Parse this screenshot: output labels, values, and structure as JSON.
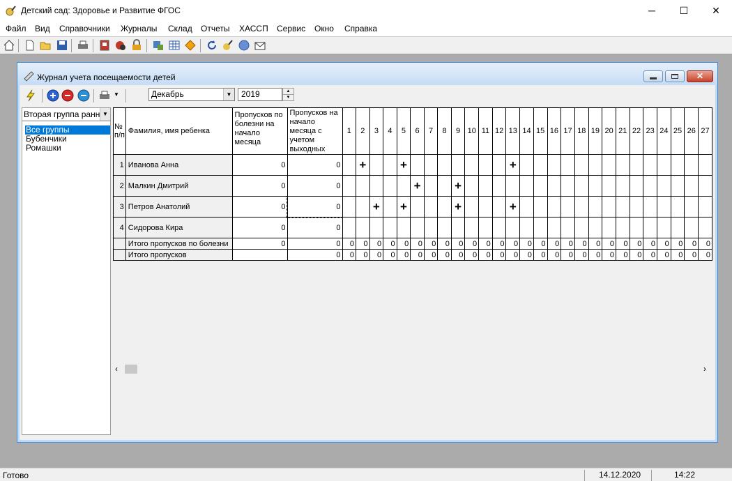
{
  "app": {
    "title": "Детский сад: Здоровье и Развитие ФГОС",
    "minimize": "─",
    "maximize": "☐",
    "close": "✕"
  },
  "menu": [
    "Файл",
    "Вид",
    "Справочники",
    "Журналы",
    "Склад",
    "Отчеты",
    "ХАССП",
    "Сервис",
    "Окно",
    "Справка"
  ],
  "child": {
    "title": "Журнал учета посещаемости детей",
    "month": "Декабрь",
    "year": "2019"
  },
  "groups": {
    "selected": "Вторая группа ранне",
    "items": [
      "Все группы",
      "Бубенчики",
      "Ромашки"
    ]
  },
  "grid": {
    "headers": {
      "num": "№ п/п",
      "name": "Фамилия, имя ребенка",
      "sick": "Пропусков по болезни на начало месяца",
      "total": "Пропусков на начало месяца с учетом выходных"
    },
    "days": [
      "1",
      "2",
      "3",
      "4",
      "5",
      "6",
      "7",
      "8",
      "9",
      "10",
      "11",
      "12",
      "13",
      "14",
      "15",
      "16",
      "17",
      "18",
      "19",
      "20",
      "21",
      "22",
      "23",
      "24",
      "25",
      "26",
      "27"
    ],
    "rows": [
      {
        "num": "1",
        "name": "Иванова Анна",
        "sick": "0",
        "total": "0",
        "marks": [
          2,
          5,
          13
        ]
      },
      {
        "num": "2",
        "name": "Малкин Дмитрий",
        "sick": "0",
        "total": "0",
        "marks": [
          6,
          9
        ]
      },
      {
        "num": "3",
        "name": "Петров Анатолий",
        "sick": "0",
        "total": "0",
        "marks": [
          3,
          5,
          9,
          13
        ]
      },
      {
        "num": "4",
        "name": "Сидорова Кира",
        "sick": "0",
        "total": "0",
        "marks": []
      }
    ],
    "mark_symbol": "+",
    "totals": [
      {
        "label": "Итого пропусков по болезни",
        "sick": "0",
        "total": "0",
        "day_value": "0"
      },
      {
        "label": "Итого пропусков",
        "sick": "",
        "total": "0",
        "day_value": "0"
      }
    ]
  },
  "status": {
    "text": "Готово",
    "date": "14.12.2020",
    "time": "14:22"
  },
  "icons": [
    "app-icon",
    "home-icon",
    "new-icon",
    "open-icon",
    "save-icon",
    "print-icon",
    "journal-icon",
    "lock-icon",
    "refresh-icon",
    "mail-icon",
    "lightning-icon",
    "add-icon",
    "remove-icon",
    "minus-icon"
  ]
}
